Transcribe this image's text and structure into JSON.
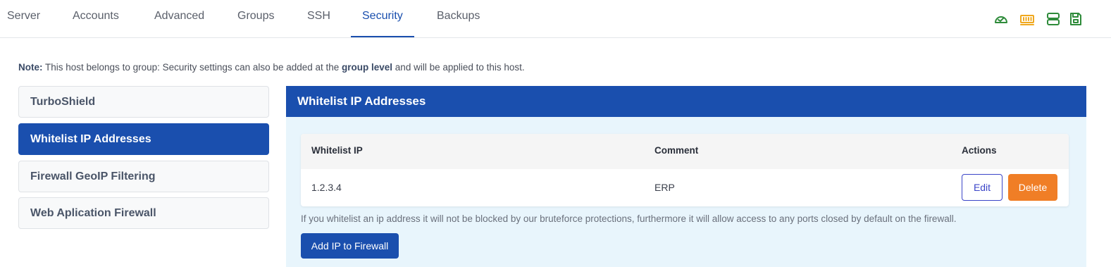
{
  "nav": {
    "tabs": [
      {
        "label": "Server"
      },
      {
        "label": "Accounts"
      },
      {
        "label": "Advanced"
      },
      {
        "label": "Groups"
      },
      {
        "label": "SSH"
      },
      {
        "label": "Security",
        "active": true
      },
      {
        "label": "Backups"
      }
    ],
    "tool_icons": [
      {
        "name": "dashboard-gauge-icon",
        "color": "#2e8b3a"
      },
      {
        "name": "memory-icon",
        "color": "#f0a81e"
      },
      {
        "name": "server-icon",
        "color": "#2e8b3a"
      },
      {
        "name": "save-icon",
        "color": "#2e8b3a"
      }
    ]
  },
  "note": {
    "prefix": "Note:",
    "text_before": " This host belongs to group: Security settings can also be added at the ",
    "emphasis": "group level",
    "text_after": " and will be applied to this host."
  },
  "sidebar": {
    "items": [
      {
        "label": "TurboShield"
      },
      {
        "label": "Whitelist IP Addresses",
        "active": true
      },
      {
        "label": "Firewall GeoIP Filtering"
      },
      {
        "label": "Web Aplication Firewall"
      }
    ]
  },
  "panel": {
    "title": "Whitelist IP Addresses",
    "table": {
      "columns": [
        "Whitelist IP",
        "Comment",
        "Actions"
      ],
      "rows": [
        {
          "ip": "1.2.3.4",
          "comment": "ERP",
          "edit_label": "Edit",
          "delete_label": "Delete"
        }
      ]
    },
    "help_text": "If you whitelist an ip address it will not be blocked by our bruteforce protections, furthermore it will allow access to any ports closed by default on the firewall.",
    "add_button": "Add IP to Firewall"
  },
  "colors": {
    "accent": "#1a4fae",
    "panel_bg": "#e8f5fc",
    "delete": "#f07e26",
    "edit_border": "#3b45c8"
  }
}
